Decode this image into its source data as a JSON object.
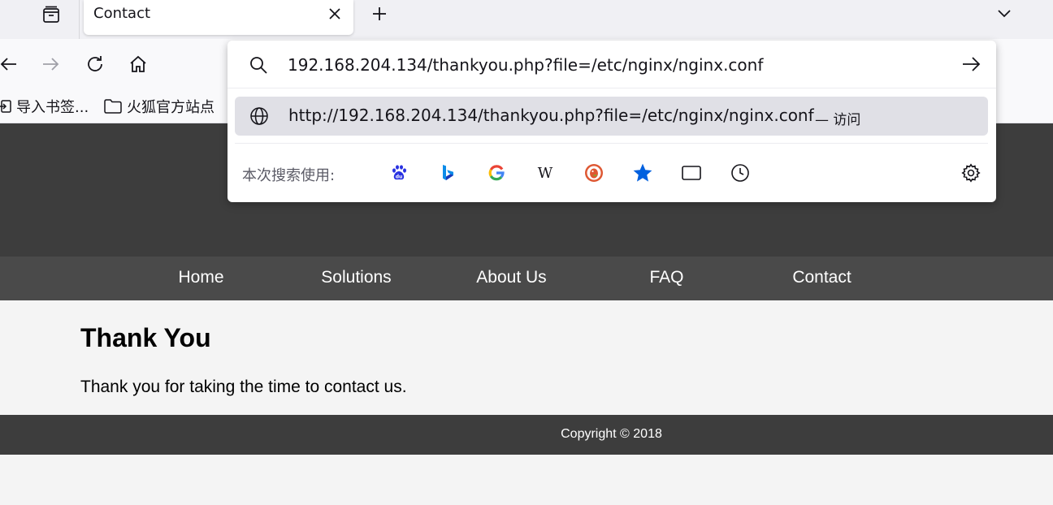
{
  "browser": {
    "tab": {
      "title": "Contact"
    },
    "bookmarks": [
      {
        "label": "导入书签...",
        "icon": "import-icon"
      },
      {
        "label": "火狐官方站点",
        "icon": "folder-icon"
      }
    ],
    "urlbar": {
      "value": "192.168.204.134/thankyou.php?file=/etc/nginx/nginx.conf",
      "suggestion_url": "http://192.168.204.134/thankyou.php?file=/etc/nginx/nginx.conf",
      "suggestion_action": "— 访问",
      "engines_label": "本次搜索使用:",
      "engines": [
        "baidu-icon",
        "bing-icon",
        "google-icon",
        "wikipedia-icon",
        "duckduckgo-icon",
        "bookmarks-star-icon",
        "tabs-icon",
        "history-icon"
      ]
    }
  },
  "site": {
    "nav": [
      "Home",
      "Solutions",
      "About Us",
      "FAQ",
      "Contact"
    ],
    "heading": "Thank You",
    "message": "Thank you for taking the time to contact us.",
    "footer": "Copyright © 2018"
  },
  "colors": {
    "header_bg": "#3d3d3d",
    "nav_bg": "#4a4a4a",
    "page_bg": "#f4f4f4",
    "star_blue": "#0060df"
  }
}
